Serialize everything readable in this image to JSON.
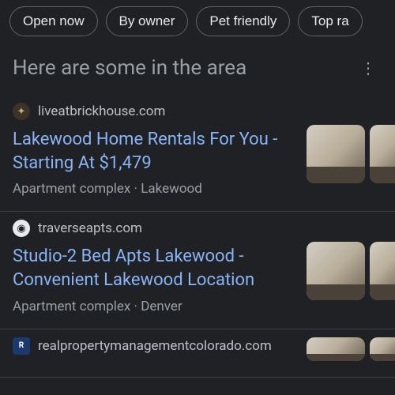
{
  "chips": [
    "Open now",
    "By owner",
    "Pet friendly",
    "Top ra"
  ],
  "section_title": "Here are some in the area",
  "results": [
    {
      "site": "liveatbrickhouse.com",
      "title": "Lakewood Home Rentals For You - Starting At $1,479",
      "meta": "Apartment complex · Lakewood"
    },
    {
      "site": "traverseapts.com",
      "title": "Studio-2 Bed Apts Lakewood - Convenient Lakewood Location",
      "meta": "Apartment complex · Denver"
    },
    {
      "site": "realpropertymanagementcolorado.com",
      "title": "",
      "meta": ""
    }
  ]
}
